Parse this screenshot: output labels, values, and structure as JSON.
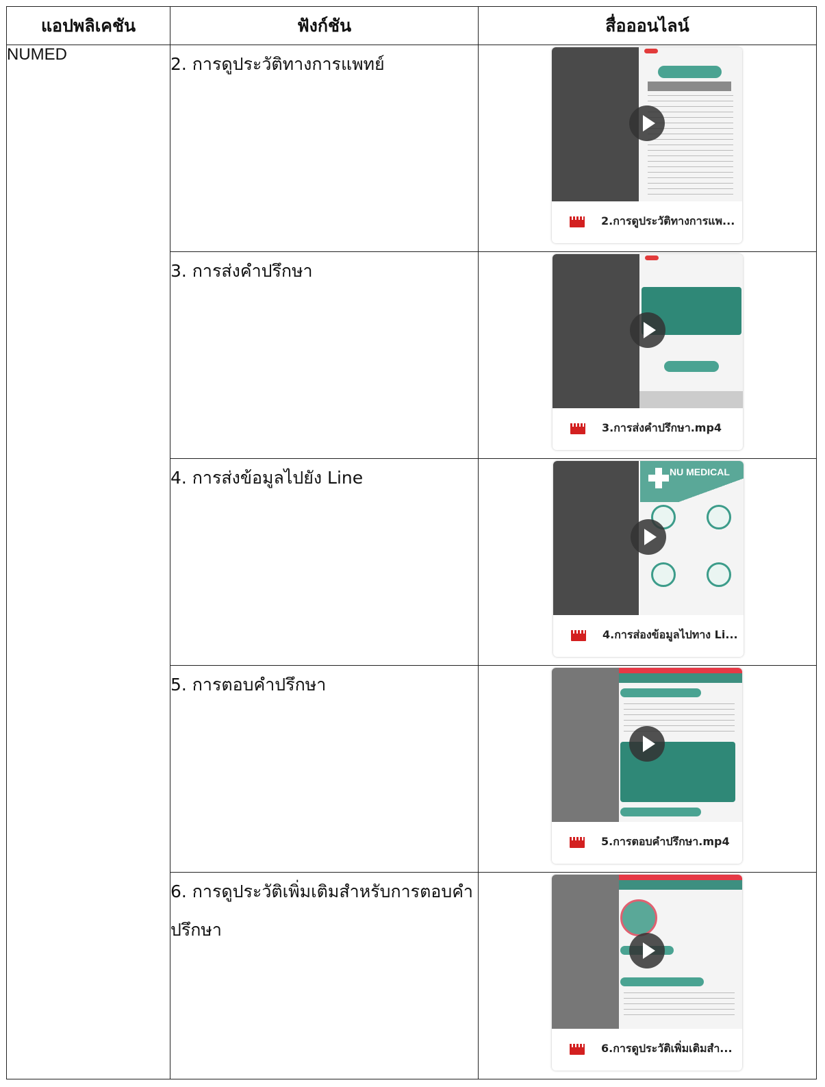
{
  "table": {
    "headers": [
      "แอปพลิเคชัน",
      "ฟังก์ชัน",
      "สื่อออนไลน์"
    ],
    "app_name": "NUMED",
    "rows": [
      {
        "function": "2. การดูประวัติทางการแพทย์",
        "video_caption": "2.การดูประวัติทางการแพ..."
      },
      {
        "function": "3. การส่งคำปรึกษา",
        "video_caption": "3.การส่งคำปรึกษา.mp4"
      },
      {
        "function": "4. การส่งข้อมูลไปยัง Line",
        "video_caption": "4.การส่องข้อมูลไปทาง Li..."
      },
      {
        "function": "5. การตอบคำปรึกษา",
        "video_caption": "5.การตอบคำปรึกษา.mp4"
      },
      {
        "function": "6. การดูประวัติเพิ่มเติมสำหรับการตอบคำปรึกษา",
        "video_caption": "6.การดูประวัติเพิ่มเติมสำ..."
      }
    ]
  },
  "thumbnail_texts": {
    "nu_medical": "NU MEDICAL"
  },
  "icons": {
    "play": "play-icon",
    "video_file": "film-icon"
  },
  "colors": {
    "teal": "#4aa392",
    "film_red": "#d32020"
  }
}
